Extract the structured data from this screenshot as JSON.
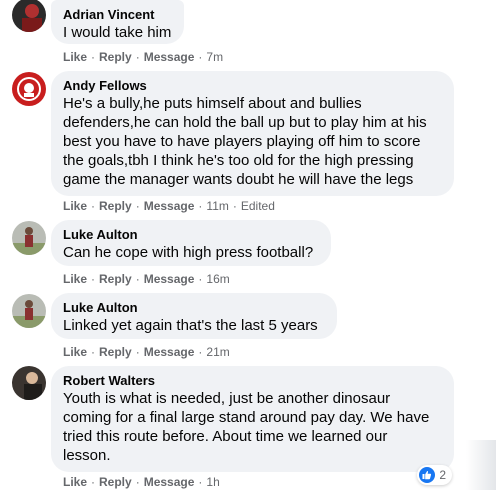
{
  "comments": [
    {
      "author": "Adrian Vincent",
      "text": "I would take him",
      "actions": {
        "like": "Like",
        "reply": "Reply",
        "message": "Message",
        "time": "7m",
        "edited": ""
      }
    },
    {
      "author": "Andy Fellows",
      "text": "He's a bully,he puts himself about and bullies\ndefenders,he can hold the ball up but to play him at his\nbest you have to have players playing off him to score\nthe goals,tbh I think he's too old for the high pressing\ngame the manager wants doubt he will have the legs",
      "actions": {
        "like": "Like",
        "reply": "Reply",
        "message": "Message",
        "time": "11m",
        "edited": "Edited"
      }
    },
    {
      "author": "Luke Aulton",
      "text": "Can he cope with high press football?",
      "actions": {
        "like": "Like",
        "reply": "Reply",
        "message": "Message",
        "time": "16m",
        "edited": ""
      }
    },
    {
      "author": "Luke Aulton",
      "text": "Linked yet again that's the last 5 years",
      "actions": {
        "like": "Like",
        "reply": "Reply",
        "message": "Message",
        "time": "21m",
        "edited": ""
      }
    },
    {
      "author": "Robert Walters",
      "text": "Youth is what is needed, just be another dinosaur\ncoming for a final large stand around pay day. We have\ntried this route before. About time we learned our\nlesson.",
      "actions": {
        "like": "Like",
        "reply": "Reply",
        "message": "Message",
        "time": "1h",
        "edited": ""
      },
      "reactions": {
        "icon": "thumbs-up-icon",
        "count": "2"
      }
    }
  ],
  "separator": "·",
  "colors": {
    "bubble": "#f0f2f5",
    "meta": "#65676b",
    "like_blue": "#1877f2"
  }
}
